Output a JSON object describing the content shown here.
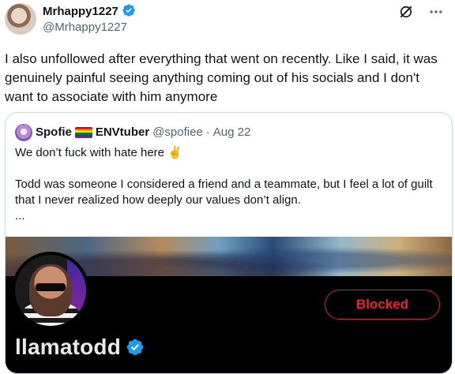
{
  "post": {
    "author_name": "Mrhappy1227",
    "author_handle": "@Mrhappy1227",
    "text": "I also unfollowed after everything that went on recently. Like I said, it was genuinely painful seeing anything coming out of his socials and I don't want to associate with him anymore"
  },
  "icons": {
    "verified": "verified-badge-icon",
    "grok": "grok-icon",
    "more": "more-icon"
  },
  "quote": {
    "author_name": "Spofie",
    "flag": "rainbow-flag-emoji",
    "author_name_suffix": "ENVtuber",
    "handle": "@spofiee",
    "separator": "·",
    "date": "Aug 22",
    "line1": "We don’t fuck with hate here ✌️",
    "line2": "Todd was someone I considered a friend and a teammate, but I feel a lot of guilt that I never realized how deeply our values don’t align.",
    "ellipsis": "..."
  },
  "profile_card": {
    "name": "llamatodd",
    "blocked_label": "Blocked"
  },
  "colors": {
    "verified_blue": "#1d9bf0",
    "blocked_red": "#f4212e",
    "secondary_text": "#536471"
  }
}
